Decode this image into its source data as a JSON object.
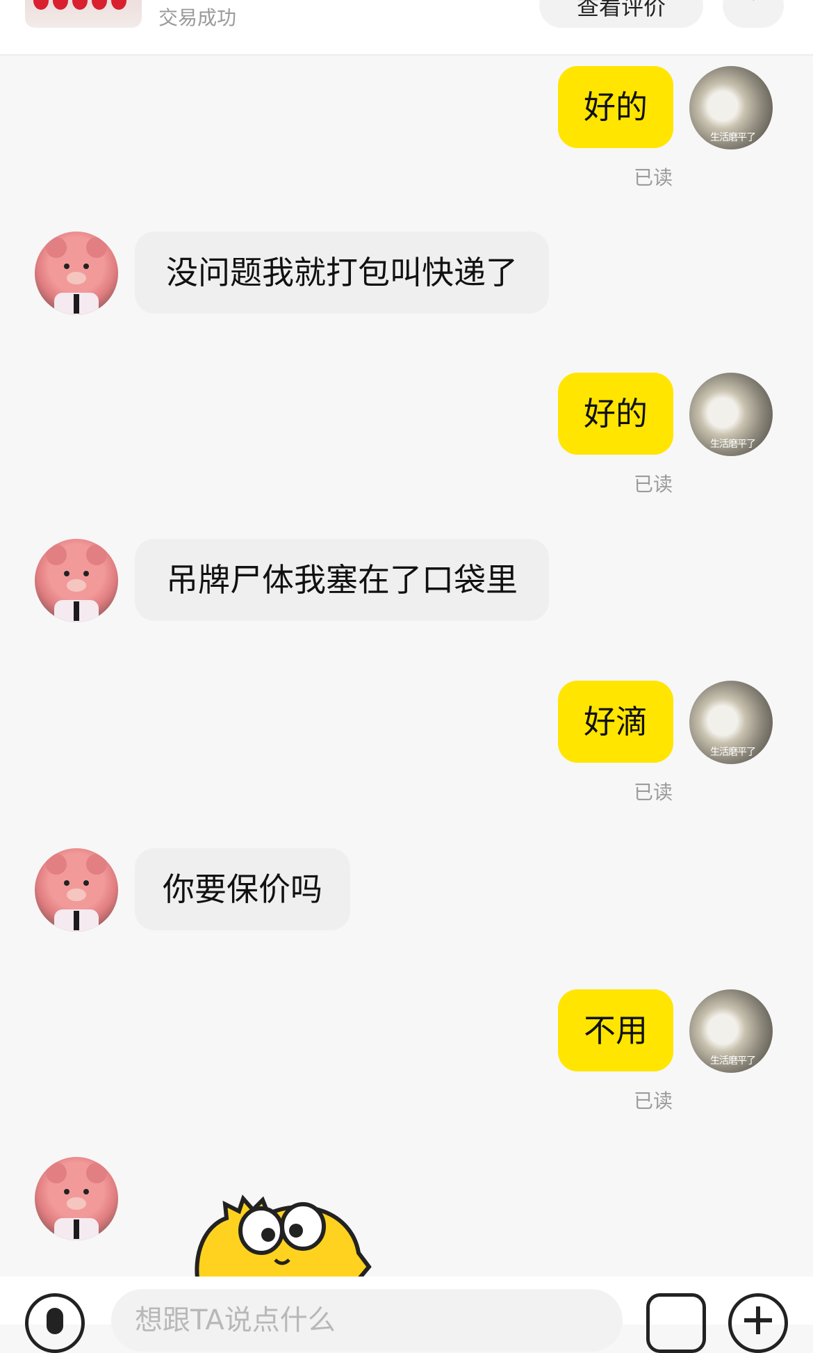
{
  "order": {
    "status": "交易成功",
    "review_button": "查看评价"
  },
  "messages": [
    {
      "from": "me",
      "text": "好的",
      "read": "已读"
    },
    {
      "from": "seller",
      "text": "没问题我就打包叫快递了"
    },
    {
      "from": "me",
      "text": "好的",
      "read": "已读"
    },
    {
      "from": "seller",
      "text": "吊牌尸体我塞在了口袋里"
    },
    {
      "from": "me",
      "text": "好滴",
      "read": "已读"
    },
    {
      "from": "seller",
      "text": "你要保价吗"
    },
    {
      "from": "me",
      "text": "不用",
      "read": "已读"
    },
    {
      "from": "seller",
      "sticker": "yellow-dinosaur-sticker"
    }
  ],
  "my_avatar_caption": "生活磨平了",
  "input": {
    "placeholder": "想跟TA说点什么"
  },
  "colors": {
    "my_bubble": "#ffe500",
    "their_bubble": "#efefef",
    "read_text": "#9b9b9b",
    "background": "#f7f7f7"
  }
}
